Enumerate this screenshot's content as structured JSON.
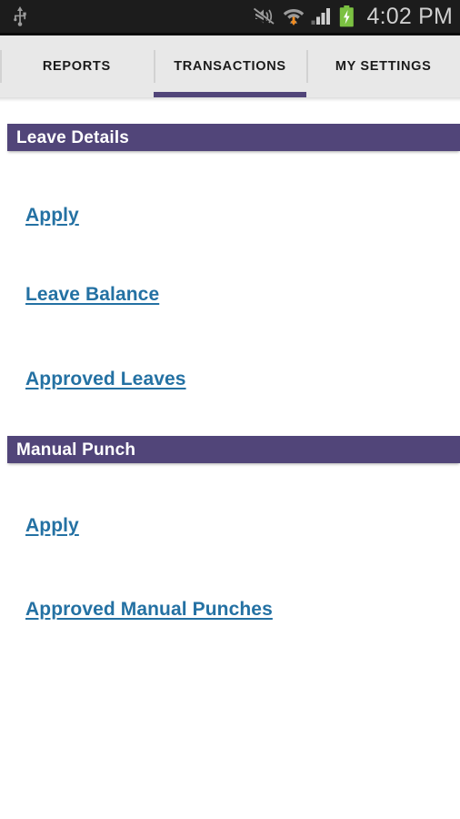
{
  "status_bar": {
    "time": "4:02 PM",
    "icons": [
      "usb-icon",
      "ringer-muted-icon",
      "wifi-download-icon",
      "cellular-signal-icon",
      "battery-charging-icon"
    ],
    "background_color": "#1c1c1c",
    "text_color": "#cfcfcf",
    "battery_color": "#7bc142"
  },
  "tabs": {
    "active_index": 1,
    "items": [
      {
        "label": "REPORTS"
      },
      {
        "label": "TRANSACTIONS"
      },
      {
        "label": "MY SETTINGS"
      }
    ],
    "indicator_color": "#514579",
    "background_color": "#e8e8e8"
  },
  "sections": [
    {
      "title": "Leave Details",
      "links": [
        {
          "label": "Apply"
        },
        {
          "label": "Leave Balance"
        },
        {
          "label": "Approved Leaves"
        }
      ]
    },
    {
      "title": "Manual Punch",
      "links": [
        {
          "label": "Apply"
        },
        {
          "label": "Approved Manual Punches"
        }
      ]
    }
  ],
  "theme": {
    "header_bar_color": "#514579",
    "link_color": "#2471a3",
    "page_background": "#ffffff"
  }
}
